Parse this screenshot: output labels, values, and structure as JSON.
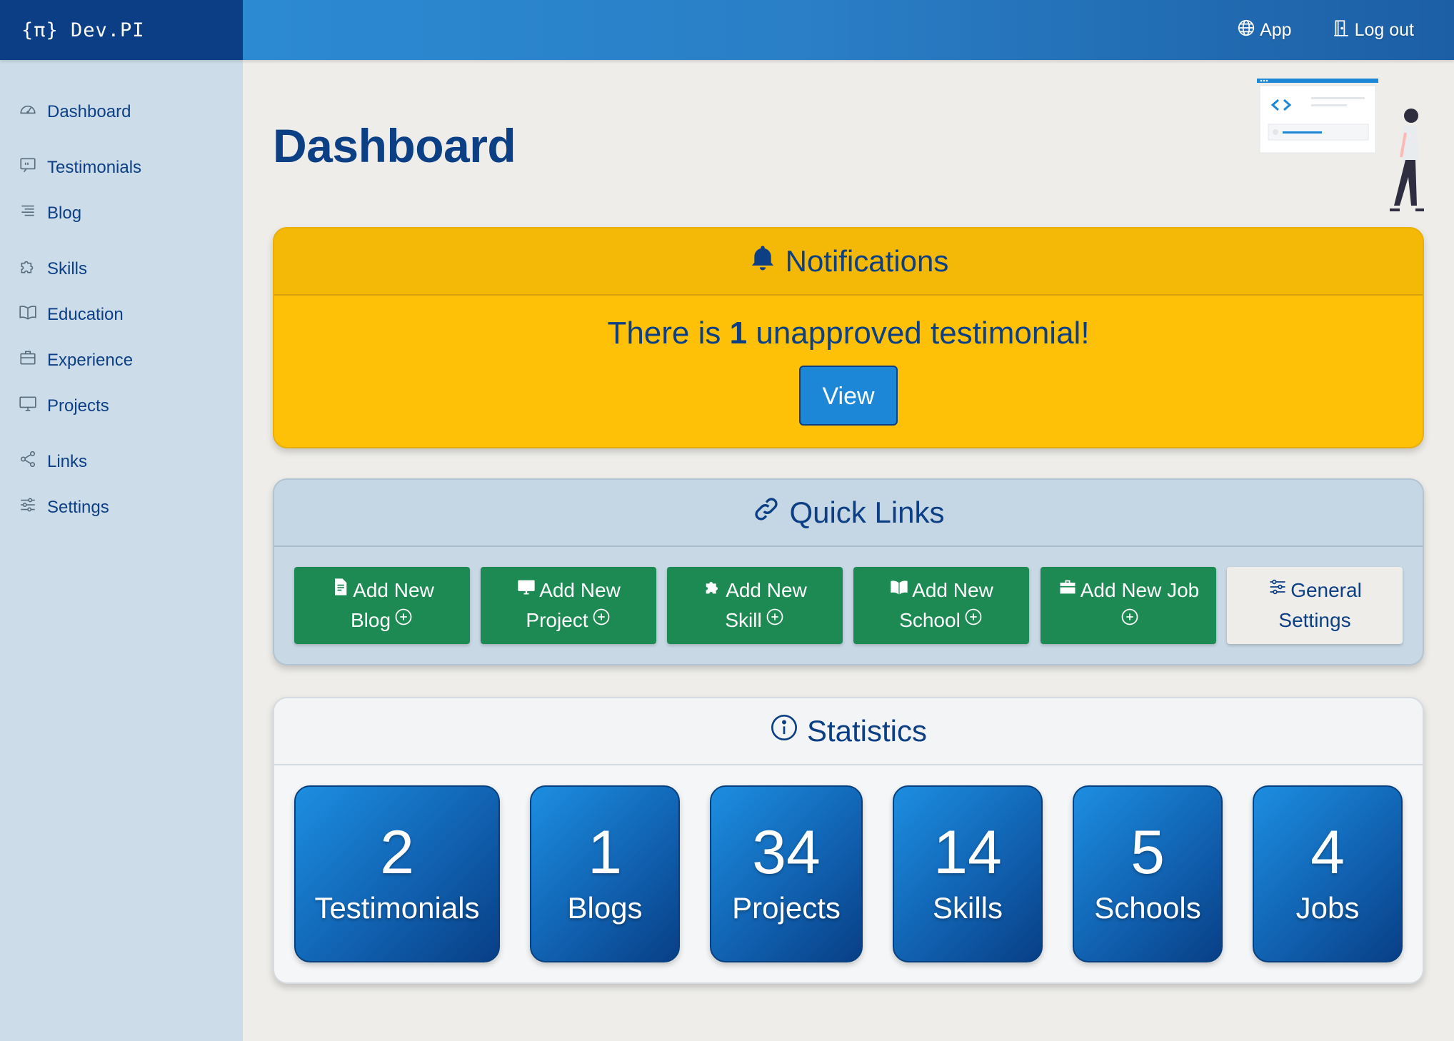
{
  "app": {
    "brand": "{π} Dev.PI"
  },
  "topbar": {
    "app_label": "App",
    "logout_label": "Log out"
  },
  "sidebar": {
    "items": [
      {
        "label": "Dashboard",
        "icon": "gauge-icon"
      },
      {
        "label": "Testimonials",
        "icon": "quote-icon"
      },
      {
        "label": "Blog",
        "icon": "list-icon"
      },
      {
        "label": "Skills",
        "icon": "puzzle-icon"
      },
      {
        "label": "Education",
        "icon": "book-icon"
      },
      {
        "label": "Experience",
        "icon": "briefcase-icon"
      },
      {
        "label": "Projects",
        "icon": "monitor-icon"
      },
      {
        "label": "Links",
        "icon": "share-icon"
      },
      {
        "label": "Settings",
        "icon": "sliders-icon"
      }
    ]
  },
  "main": {
    "title": "Dashboard"
  },
  "notifications": {
    "title": "Notifications",
    "message_prefix": "There is",
    "count": "1",
    "message_suffix": "unapproved testimonial!",
    "view_label": "View"
  },
  "quick_links": {
    "title": "Quick Links",
    "buttons": [
      {
        "line1": "Add New",
        "line2": "Blog",
        "icon": "document-icon"
      },
      {
        "line1": "Add New",
        "line2": "Project",
        "icon": "monitor-icon"
      },
      {
        "line1": "Add New",
        "line2": "Skill",
        "icon": "puzzle-icon"
      },
      {
        "line1": "Add New",
        "line2": "School",
        "icon": "book-icon"
      },
      {
        "line1": "Add New Job",
        "line2": "",
        "icon": "briefcase-icon"
      },
      {
        "line1": "General",
        "line2": "Settings",
        "icon": "sliders-icon"
      }
    ]
  },
  "statistics": {
    "title": "Statistics",
    "items": [
      {
        "value": "2",
        "label": "Testimonials"
      },
      {
        "value": "1",
        "label": "Blogs"
      },
      {
        "value": "34",
        "label": "Projects"
      },
      {
        "value": "14",
        "label": "Skills"
      },
      {
        "value": "5",
        "label": "Schools"
      },
      {
        "value": "4",
        "label": "Jobs"
      }
    ]
  },
  "colors": {
    "brand_navy": "#0b3e85",
    "header_blue": "#2a7fc6",
    "notification_yellow": "#ffc107",
    "quick_link_green": "#1d8a53",
    "sidebar_bg": "#ccdde9",
    "stat_gradient_start": "#1d8ee0",
    "stat_gradient_end": "#083f86"
  }
}
